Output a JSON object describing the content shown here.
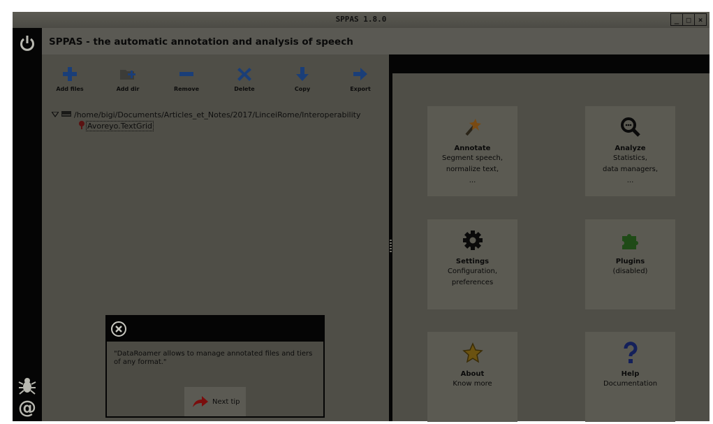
{
  "window": {
    "title": "SPPAS 1.8.0",
    "controls": [
      "_",
      "□",
      "×"
    ]
  },
  "header": {
    "title": "SPPAS - the automatic annotation and analysis of speech"
  },
  "sidebar": {
    "icons": [
      "power-icon",
      "bug-icon",
      "at-sign-icon"
    ]
  },
  "toolbar": {
    "add_files": "Add files",
    "add_dir": "Add dir",
    "remove": "Remove",
    "delete": "Delete",
    "copy": "Copy",
    "export": "Export"
  },
  "file_tree": {
    "folder_path": "/home/bigi/Documents/Articles_et_Notes/2017/LinceiRome/Interoperability",
    "files": [
      {
        "name": "Avoreyo.TextGrid"
      }
    ]
  },
  "tip_dialog": {
    "text": "\"DataRoamer allows to manage annotated files and tiers of any format.\"",
    "next_label": "Next tip"
  },
  "cards": {
    "annotate": {
      "title": "Annotate",
      "lines": [
        "Segment speech,",
        "normalize text,",
        "..."
      ]
    },
    "analyze": {
      "title": "Analyze",
      "lines": [
        "Statistics,",
        "data managers,",
        "..."
      ]
    },
    "settings": {
      "title": "Settings",
      "lines": [
        "Configuration,",
        "preferences"
      ]
    },
    "plugins": {
      "title": "Plugins",
      "lines": [
        "(disabled)"
      ]
    },
    "about": {
      "title": "About",
      "lines": [
        "Know more"
      ]
    },
    "help": {
      "title": "Help",
      "lines": [
        "Documentation"
      ]
    }
  },
  "colors": {
    "overlay_bg": "#4f4e47",
    "toolbar_blue": "#1a3e78",
    "sidebar_black": "#050505"
  }
}
